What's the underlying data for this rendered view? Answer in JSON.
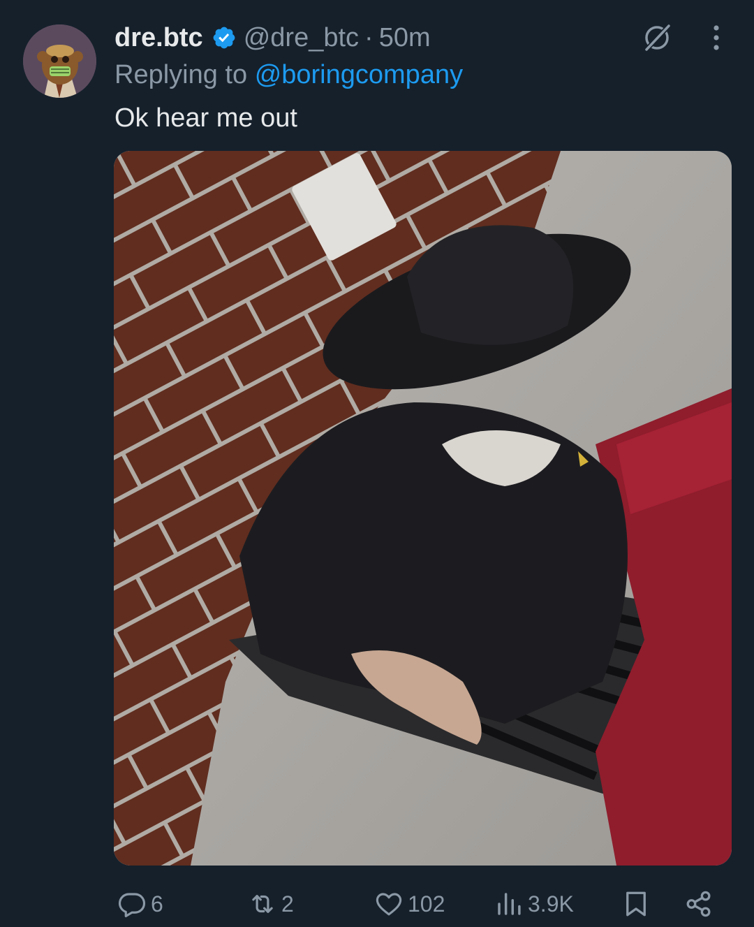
{
  "tweet": {
    "author_name": "dre.btc",
    "handle": "@dre_btc",
    "time_separator": "·",
    "time": "50m",
    "replying_prefix": "Replying to",
    "replying_mention": "@boringcompany",
    "text": "Ok hear me out"
  },
  "actions": {
    "replies": "6",
    "reposts": "2",
    "likes": "102",
    "views": "3.9K"
  },
  "icons": {
    "verified": "verified-badge-icon",
    "grok": "grok-icon",
    "more": "more-options-icon",
    "reply": "reply-icon",
    "repost": "repost-icon",
    "like": "heart-icon",
    "views": "views-icon",
    "bookmark": "bookmark-icon",
    "share": "share-icon"
  },
  "colors": {
    "background": "#15202b",
    "primary_text": "#e7e9ea",
    "secondary_text": "#8b98a5",
    "accent": "#1d9bf0"
  }
}
